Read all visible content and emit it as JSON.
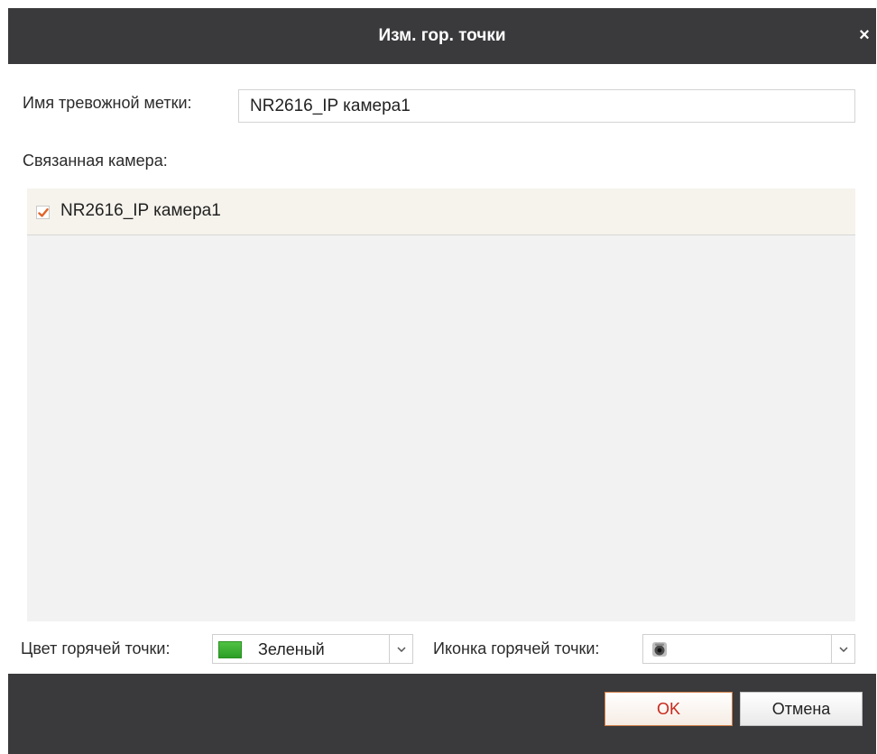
{
  "dialog": {
    "title": "Изм. гор. точки",
    "close_symbol": "×"
  },
  "form": {
    "alarm_label_text": "Имя тревожной метки:",
    "alarm_label_value": "NR2616_IP камера1",
    "linked_camera_label": "Связанная камера:",
    "cameras": [
      {
        "name": "NR2616_IP камера1",
        "checked": true
      }
    ],
    "hotspot_color_label": "Цвет горячей точки:",
    "hotspot_color_value": "Зеленый",
    "hotspot_color_hex": "#3fb536",
    "hotspot_icon_label": "Иконка горячей точки:",
    "hotspot_icon_value": "camera-icon"
  },
  "buttons": {
    "ok": "OK",
    "cancel": "Отмена"
  }
}
